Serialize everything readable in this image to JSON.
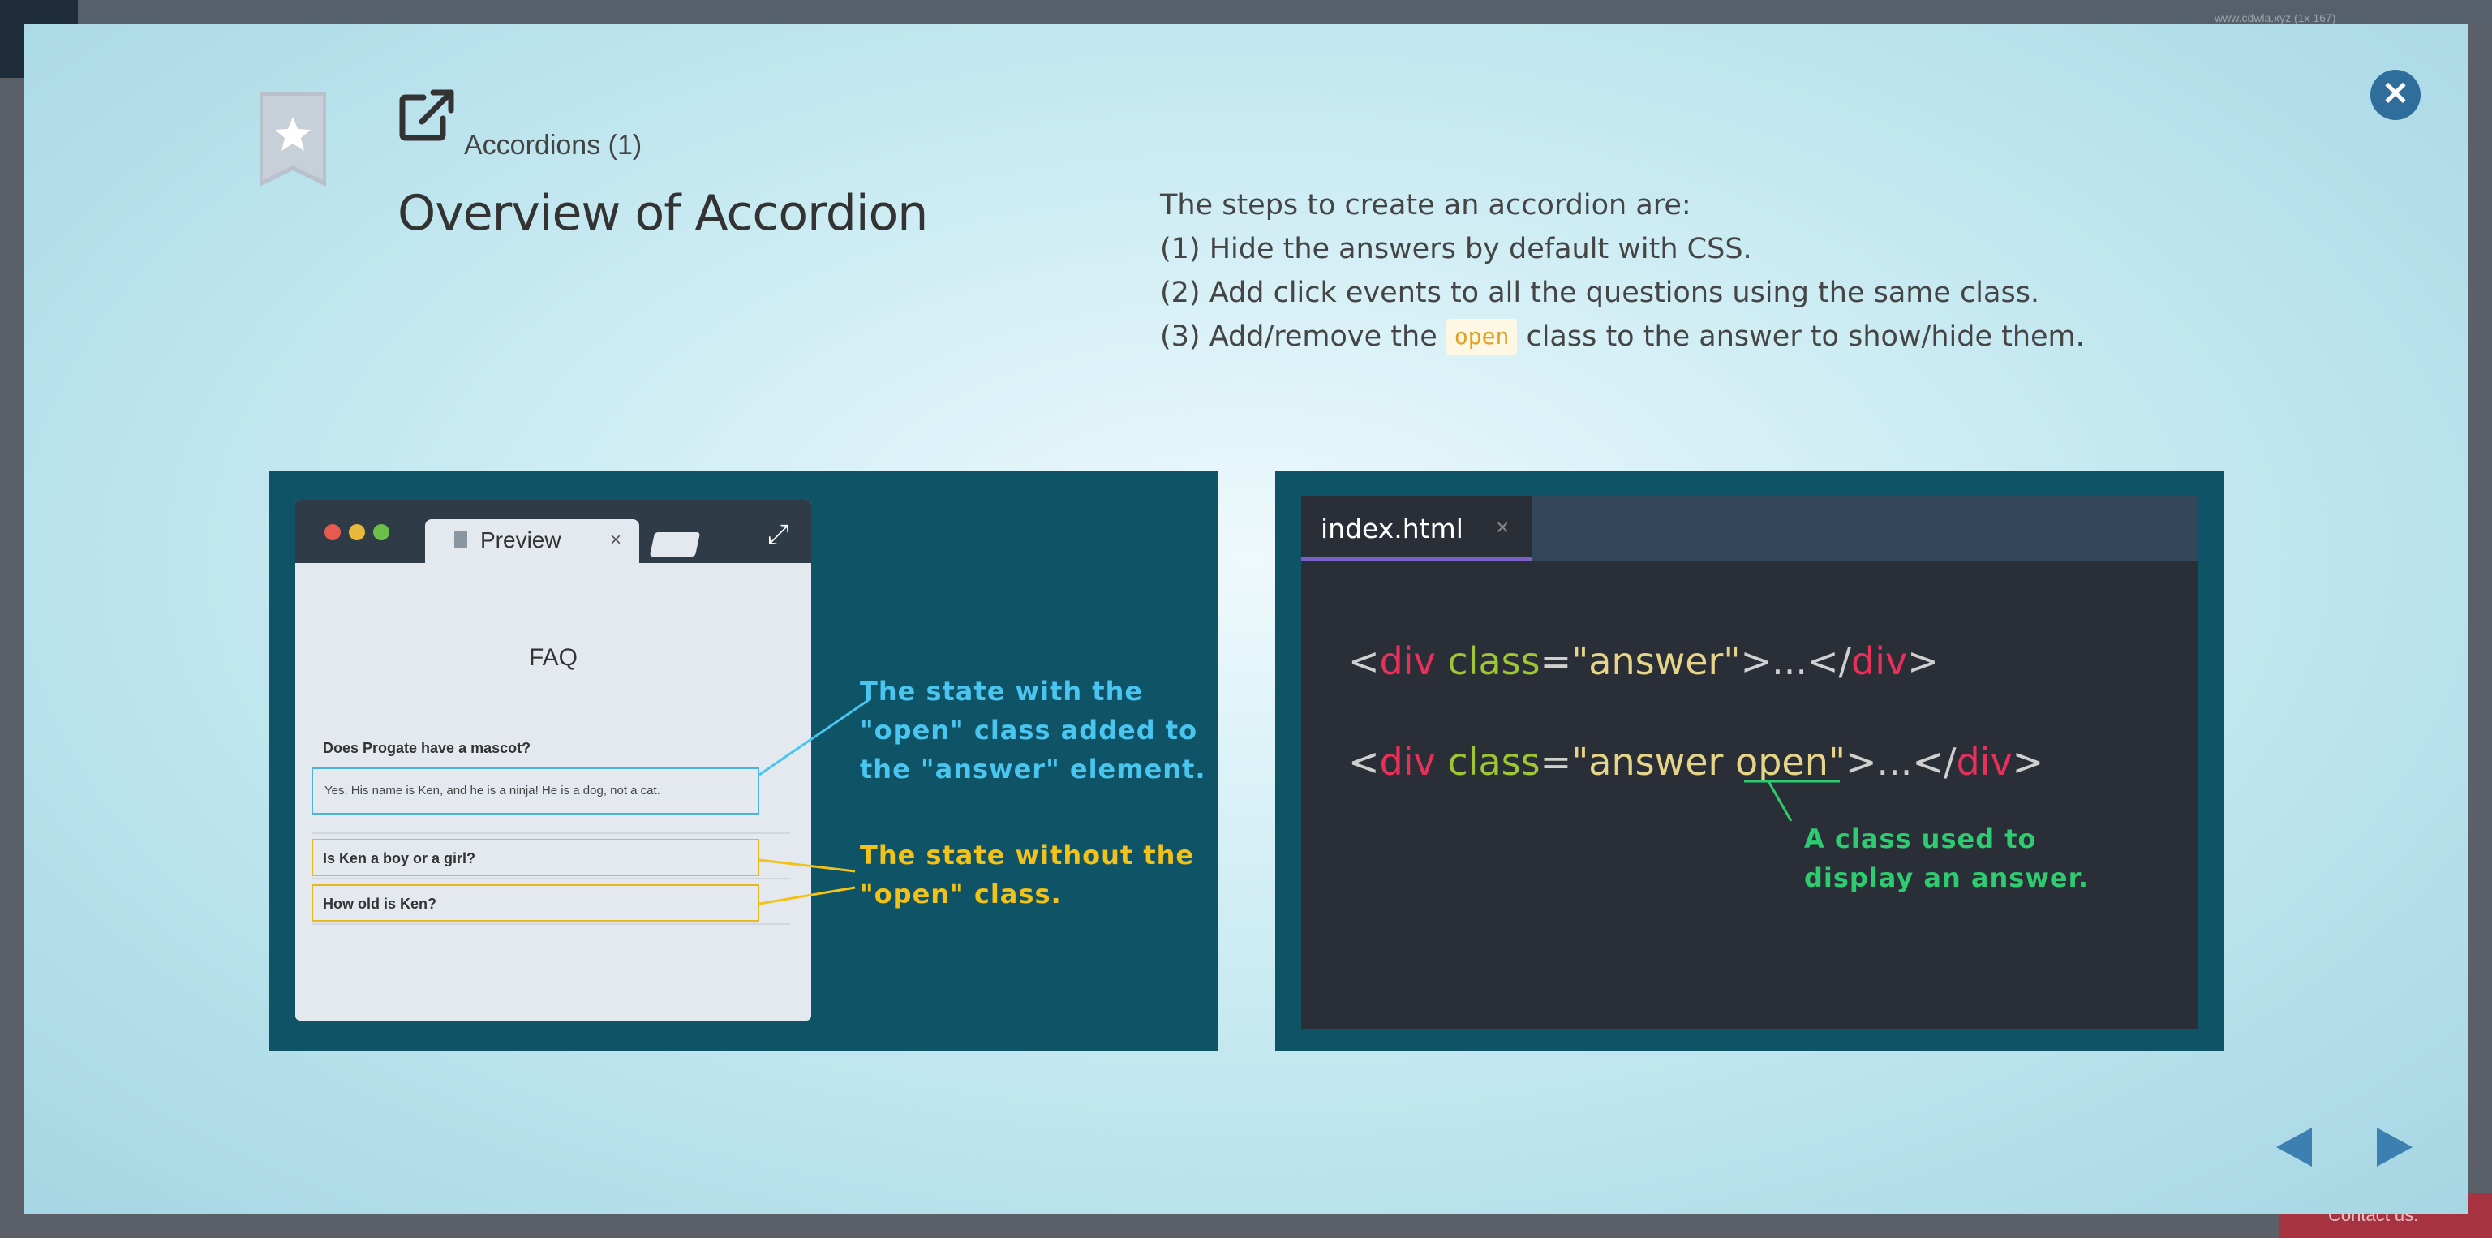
{
  "background": {
    "url_hint": "www.cdwla.xyz (1x 167)",
    "contact_label": "Contact us."
  },
  "modal": {
    "lesson_name": "Accordions (1)",
    "title": "Overview of Accordion",
    "steps": {
      "intro": "The steps to create an accordion are:",
      "step1": "(1) Hide the answers by default with CSS.",
      "step2": "(2) Add click events to all the questions using the same class.",
      "step3_before": "(3) Add/remove the",
      "step3_code": "open",
      "step3_after": "class to the answer to show/hide them."
    },
    "icons": {
      "close": "close-icon",
      "bookmark": "bookmark-star-icon",
      "external": "external-link-icon",
      "prev": "arrow-left-icon",
      "next": "arrow-right-icon"
    },
    "colors": {
      "accent": "#2f6e9a",
      "panel": "#0e5366",
      "annotation_blue": "#49c5ef",
      "annotation_yellow": "#f2c219",
      "annotation_green": "#2ecc71"
    }
  },
  "left_slide": {
    "browser_tab": "Preview",
    "tab_close": "×",
    "faq_title": "FAQ",
    "q1": "Does Progate have a mascot?",
    "a1": "Yes. His name is Ken, and he is a ninja! He is a dog, not a cat.",
    "q2": "Is Ken a boy or a girl?",
    "q3": "How old is Ken?",
    "annotation_open": [
      "The state with the",
      "\"open\" class added to",
      "the \"answer\" element."
    ],
    "annotation_closed": [
      "The state without the",
      "\"open\" class."
    ]
  },
  "right_slide": {
    "file_tab": "index.html",
    "tab_close": "×",
    "line1": {
      "lt": "<",
      "tag": "div",
      "attr": "class",
      "eq": "=",
      "value": "\"answer\"",
      "mid": ">...</",
      "close_tag": "div",
      "gt": ">"
    },
    "line2": {
      "lt": "<",
      "tag": "div",
      "attr": "class",
      "eq": "=",
      "value": "\"answer open\"",
      "mid": ">...</",
      "close_tag": "div",
      "gt": ">"
    },
    "annotation": [
      "A class used to",
      "display an answer."
    ]
  }
}
